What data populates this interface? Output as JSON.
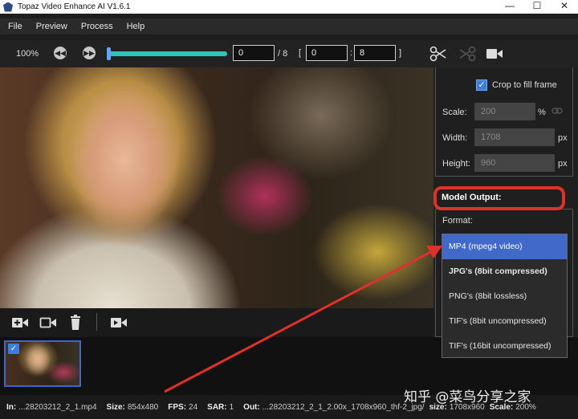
{
  "window": {
    "title": "Topaz Video Enhance AI V1.6.1",
    "min": "—",
    "max": "☐",
    "close": "✕"
  },
  "menu": [
    "File",
    "Preview",
    "Process",
    "Help"
  ],
  "toolbar": {
    "zoom": "100%",
    "frame_current": "0",
    "frame_total": "/ 8",
    "range_open": "[",
    "range_start": "0",
    "range_sep": ":",
    "range_end": "8",
    "range_close": "]",
    "progress": 0.0
  },
  "right_panel": {
    "crop_label": "Crop to fill frame",
    "crop_checked": true,
    "scale_label": "Scale:",
    "scale_value": "200",
    "scale_unit": "%",
    "width_label": "Width:",
    "width_value": "1708",
    "width_unit": "px",
    "height_label": "Height:",
    "height_value": "960",
    "height_unit": "px",
    "model_output_label": "Model Output:",
    "format_label": "Format:"
  },
  "format_options": [
    {
      "label": "MP4 (mpeg4 video)",
      "selected": true,
      "bold": false
    },
    {
      "label": "JPG's (8bit compressed)",
      "selected": false,
      "bold": true
    },
    {
      "label": "PNG's (8bit lossless)",
      "selected": false,
      "bold": false
    },
    {
      "label": "TIF's (8bit uncompressed)",
      "selected": false,
      "bold": false
    },
    {
      "label": "TIF's (16bit uncompressed)",
      "selected": false,
      "bold": false
    }
  ],
  "status": {
    "in_label": "In:",
    "in_value": "...28203212_2_1.mp4",
    "size_label": "Size:",
    "size_value": "854x480",
    "fps_label": "FPS:",
    "fps_value": "24",
    "sar_label": "SAR:",
    "sar_value": "1",
    "out_label": "Out:",
    "out_value": "...28203212_2_1_2.00x_1708x960_thf-2_jpg/",
    "out_size_label": "size:",
    "out_size_value": "1708x960",
    "scale_label": "Scale:",
    "scale_value": "200%"
  },
  "watermark": "知乎 @菜鸟分享之家",
  "colors": {
    "accent": "#3b7de0",
    "highlight": "#e0302a",
    "slider": "#2ec4b6",
    "selected": "#4169c9"
  }
}
